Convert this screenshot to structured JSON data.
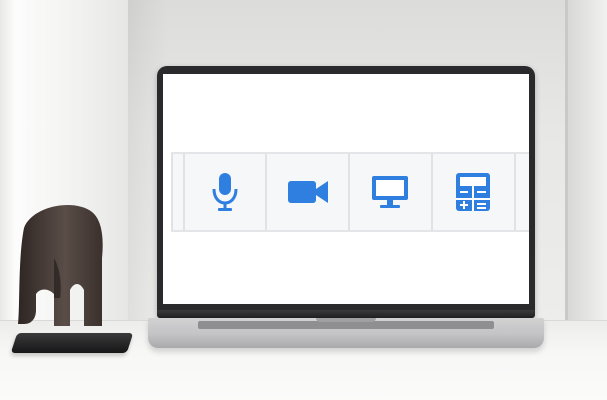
{
  "colors": {
    "accent": "#2f7fe0",
    "toolbar_bg": "#f6f7f8",
    "screen_bg": "#ffffff"
  },
  "toolbar": {
    "buttons": [
      {
        "icon": "microphone-icon"
      },
      {
        "icon": "video-camera-icon"
      },
      {
        "icon": "monitor-icon"
      },
      {
        "icon": "calculator-icon"
      }
    ]
  }
}
